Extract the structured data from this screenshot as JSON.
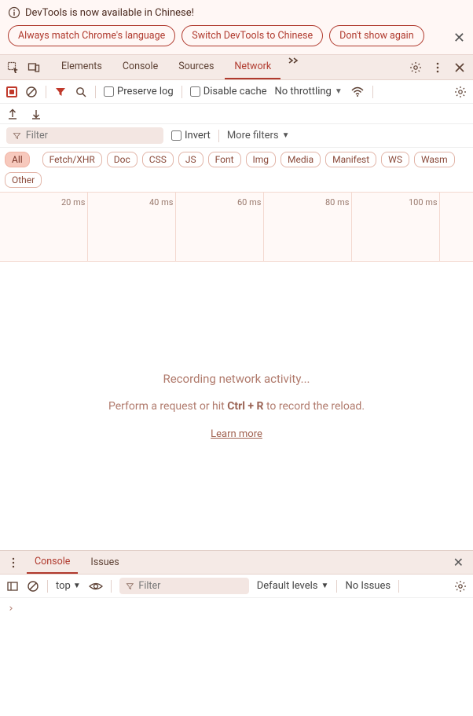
{
  "banner": {
    "title": "DevTools is now available in Chinese!",
    "btn1": "Always match Chrome's language",
    "btn2": "Switch DevTools to Chinese",
    "btn3": "Don't show again"
  },
  "tabs": {
    "elements": "Elements",
    "console": "Console",
    "sources": "Sources",
    "network": "Network"
  },
  "netToolbar": {
    "preserve": "Preserve log",
    "disable": "Disable cache",
    "throttle": "No throttling"
  },
  "filterRow": {
    "filter": "Filter",
    "invert": "Invert",
    "more": "More filters"
  },
  "chips": {
    "all": "All",
    "fetch": "Fetch/XHR",
    "doc": "Doc",
    "css": "CSS",
    "js": "JS",
    "font": "Font",
    "img": "Img",
    "media": "Media",
    "manifest": "Manifest",
    "ws": "WS",
    "wasm": "Wasm",
    "other": "Other"
  },
  "timeline": {
    "t1": "20 ms",
    "t2": "40 ms",
    "t3": "60 ms",
    "t4": "80 ms",
    "t5": "100 ms"
  },
  "empty": {
    "line1": "Recording network activity...",
    "line2a": "Perform a request or hit ",
    "line2b": "Ctrl + R",
    "line2c": " to record the reload.",
    "link": "Learn more"
  },
  "drawer": {
    "console": "Console",
    "issues": "Issues"
  },
  "consoleToolbar": {
    "ctx": "top",
    "filter": "Filter",
    "levels": "Default levels",
    "noIssues": "No Issues"
  }
}
